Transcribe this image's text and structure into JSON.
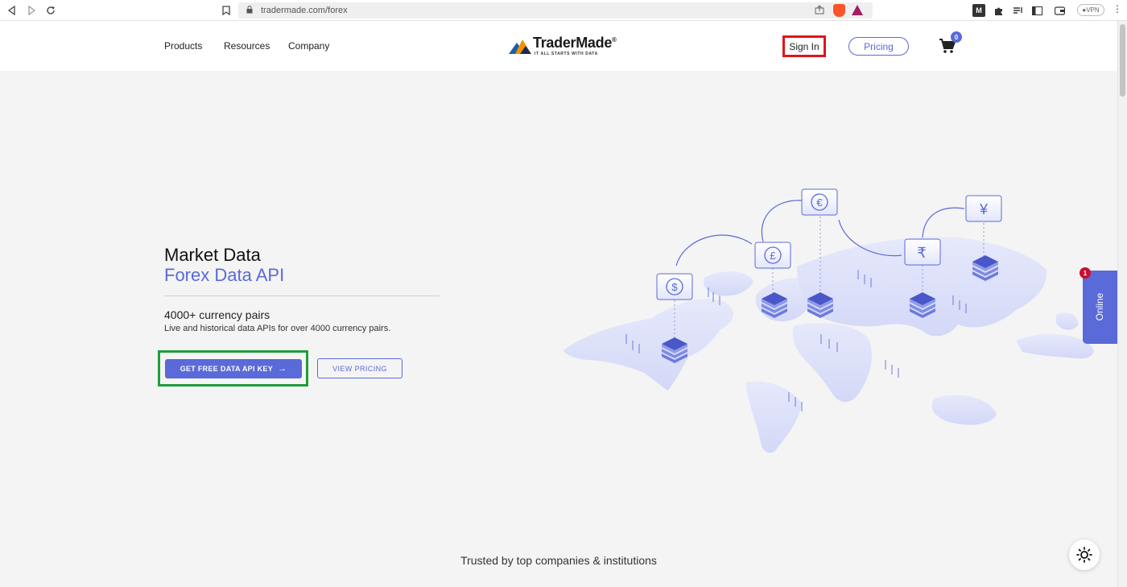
{
  "browser": {
    "url": "tradermade.com/forex",
    "brave_count": "2",
    "vpn_label": "VPN"
  },
  "header": {
    "nav": [
      "Products",
      "Resources",
      "Company"
    ],
    "logo_name": "TraderMade",
    "logo_reg": "®",
    "logo_tagline": "IT ALL STARTS WITH DATA",
    "signin_label": "Sign In",
    "pricing_label": "Pricing",
    "cart_count": "0"
  },
  "hero": {
    "title": "Market Data",
    "subtitle": "Forex Data API",
    "heading": "4000+ currency pairs",
    "description": "Live and historical data APIs for over 4000 currency pairs.",
    "cta_label": "GET FREE DATA API KEY",
    "cta_arrow": "→",
    "secondary_label": "VIEW PRICING"
  },
  "map": {
    "currencies": [
      "$",
      "£",
      "€",
      "₹",
      "¥"
    ]
  },
  "widget": {
    "online_label": "Online",
    "online_badge": "1"
  },
  "trusted_text": "Trusted by top companies & institutions",
  "icons": {
    "back": "back-icon",
    "forward": "forward-icon",
    "reload": "reload-icon",
    "bookmark": "bookmark-icon",
    "share": "share-icon",
    "cart": "cart-icon",
    "theme": "sun-icon"
  },
  "colors": {
    "brand": "#5a6ad8",
    "signin_highlight": "#e0141b",
    "cta_highlight": "#1f9e3a"
  }
}
